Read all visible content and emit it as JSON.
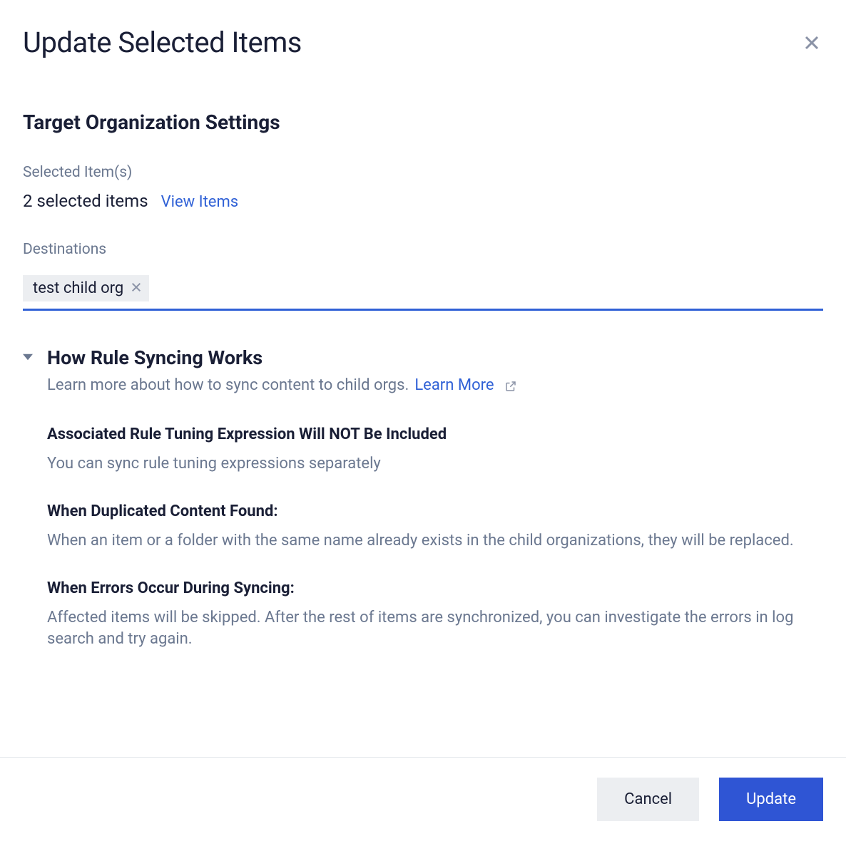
{
  "modal": {
    "title": "Update Selected Items",
    "section_title": "Target Organization Settings",
    "selected_label": "Selected Item(s)",
    "selected_count_text": "2 selected items",
    "view_items_label": "View Items",
    "destinations_label": "Destinations",
    "destinations": [
      {
        "name": "test child org"
      }
    ],
    "how": {
      "title": "How Rule Syncing Works",
      "subtitle_prefix": "Learn more about how to sync content to child orgs.",
      "learn_more_label": "Learn More",
      "blocks": [
        {
          "heading": "Associated Rule Tuning Expression Will NOT Be Included",
          "body": "You can sync rule tuning expressions separately"
        },
        {
          "heading": "When Duplicated Content Found:",
          "body": "When an item or a folder with the same name already exists in the child organizations, they will be replaced."
        },
        {
          "heading": "When Errors Occur During Syncing:",
          "body": "Affected items will be skipped. After the rest of items are synchronized, you can investigate the errors in log search and try again."
        }
      ]
    }
  },
  "footer": {
    "cancel_label": "Cancel",
    "update_label": "Update"
  }
}
